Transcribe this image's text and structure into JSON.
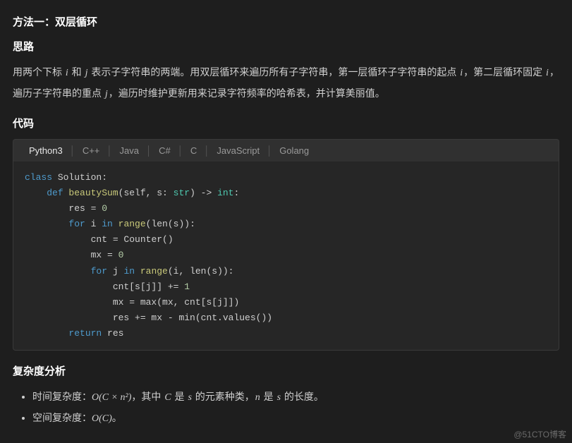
{
  "title": "方法一：双层循环",
  "section_silu_title": "思路",
  "para_parts": {
    "p1": "用两个下标 ",
    "p2": " 和 ",
    "p3": " 表示子字符串的两端。用双层循环来遍历所有子字符串，第一层循环子字符串的起点 ",
    "p4": "，第二层循环固定 ",
    "p5": "，遍历子字符串的重点 ",
    "p6": "，遍历时维护更新用来记录字符频率的哈希表，并计算美丽值。"
  },
  "vars": {
    "i": "i",
    "j": "j",
    "C": "C",
    "n": "n",
    "s": "s"
  },
  "section_code_title": "代码",
  "tabs": {
    "active": "Python3",
    "others": [
      "C++",
      "Java",
      "C#",
      "C",
      "JavaScript",
      "Golang"
    ]
  },
  "code": {
    "l1_kw": "class",
    "l1_rest": " Solution:",
    "l2_kw1": "def",
    "l2_fn": " beautySum",
    "l2_sig1": "(self, s: ",
    "l2_type": "str",
    "l2_sig2": ") -> ",
    "l2_ret": "int",
    "l2_sig3": ":",
    "l3_a": "res = ",
    "l3_n": "0",
    "l4_for": "for",
    "l4_mid": " i ",
    "l4_in": "in",
    "l4_call": " range",
    "l4_tail": "(len(s)):",
    "l5": "cnt = Counter()",
    "l6_a": "mx = ",
    "l6_n": "0",
    "l7_for": "for",
    "l7_mid": " j ",
    "l7_in": "in",
    "l7_call": " range",
    "l7_tail": "(i, len(s)):",
    "l8_a": "cnt[s[j]] += ",
    "l8_n": "1",
    "l9": "mx = max(mx, cnt[s[j]])",
    "l10": "res += mx - min(cnt.values())",
    "l11_kw": "return",
    "l11_rest": " res"
  },
  "section_complexity_title": "复杂度分析",
  "complexity": {
    "time_prefix": "时间复杂度：",
    "time_bigO": "O(C × n²)",
    "time_mid1": "，其中 ",
    "time_mid2": " 是 ",
    "time_mid3": " 的元素种类，",
    "time_mid4": " 是 ",
    "time_mid5": " 的长度。",
    "space_prefix": "空间复杂度：",
    "space_bigO": "O(C)",
    "space_suffix": "。"
  },
  "watermark": "@51CTO博客"
}
